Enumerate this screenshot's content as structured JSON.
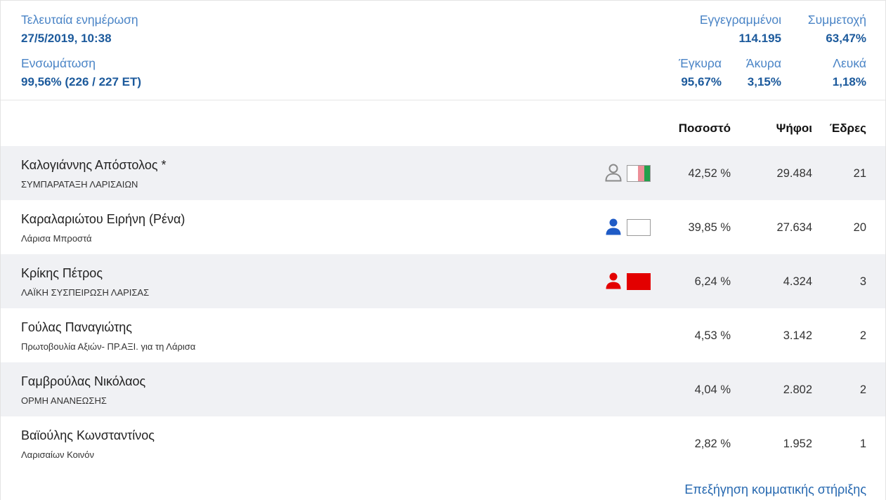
{
  "summary": {
    "last_update_label": "Τελευταία ενημέρωση",
    "last_update_value": "27/5/2019, 10:38",
    "integration_label": "Ενσωμάτωση",
    "integration_value": "99,56% (226 / 227 ΕΤ)",
    "registered_label": "Εγγεγραμμένοι",
    "registered_value": "114.195",
    "turnout_label": "Συμμετοχή",
    "turnout_value": "63,47%",
    "valid_label": "Έγκυρα",
    "valid_value": "95,67%",
    "invalid_label": "Άκυρα",
    "invalid_value": "3,15%",
    "blank_label": "Λευκά",
    "blank_value": "1,18%"
  },
  "table": {
    "col_percent": "Ποσοστό",
    "col_votes": "Ψήφοι",
    "col_seats": "Έδρες",
    "rows": [
      {
        "name": "Καλογιάννης Απόστολος *",
        "party": "ΣΥΜΠΑΡΑΤΑΞΗ ΛΑΡΙΣΑΙΩΝ",
        "percent": "42,52 %",
        "votes": "29.484",
        "seats": "21",
        "icon": "person-outline-icon",
        "icon_color": "#8a8a8a",
        "flag_colors": [
          "#ffffff",
          "#ec8f98",
          "#23a04c"
        ]
      },
      {
        "name": "Καραλαριώτου Ειρήνη (Ρένα)",
        "party": "Λάρισα Μπροστά",
        "percent": "39,85 %",
        "votes": "27.634",
        "seats": "20",
        "icon": "person-icon",
        "icon_color": "#1f5bc6",
        "flag_colors": [
          "#ffffff"
        ]
      },
      {
        "name": "Κρίκης Πέτρος",
        "party": "ΛΑΪΚΗ ΣΥΣΠΕΙΡΩΣΗ ΛΑΡΙΣΑΣ",
        "percent": "6,24 %",
        "votes": "4.324",
        "seats": "3",
        "icon": "person-icon",
        "icon_color": "#e30000",
        "flag_colors": [
          "#e30000"
        ]
      },
      {
        "name": "Γούλας Παναγιώτης",
        "party": "Πρωτοβουλία Αξιών- ΠΡ.ΑΞΙ. για τη Λάρισα",
        "percent": "4,53 %",
        "votes": "3.142",
        "seats": "2"
      },
      {
        "name": "Γαμβρούλας Νικόλαος",
        "party": "ΟΡΜΗ ΑΝΑΝΕΩΣΗΣ",
        "percent": "4,04 %",
        "votes": "2.802",
        "seats": "2"
      },
      {
        "name": "Βαϊούλης Κωνσταντίνος",
        "party": "Λαρισαίων Κοινόν",
        "percent": "2,82 %",
        "votes": "1.952",
        "seats": "1"
      }
    ]
  },
  "footer": {
    "explanation_link": "Επεξήγηση κομματικής στήριξης"
  },
  "colors": {
    "label": "#4a84c6",
    "value": "#1c5a9c",
    "link": "#2668b0",
    "row_alt_bg": "#f0f1f4"
  }
}
